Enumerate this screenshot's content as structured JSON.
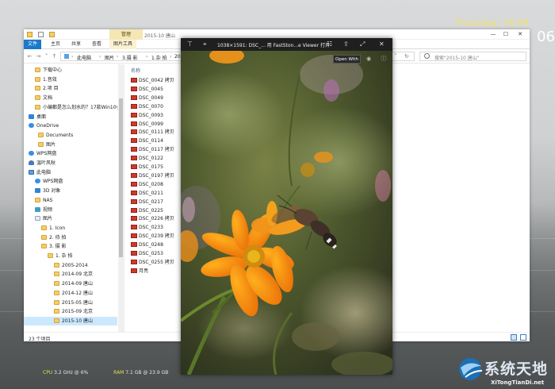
{
  "clock": {
    "day_time": "Thursday, 16:04",
    "big": "06"
  },
  "explorer": {
    "ribbon_context": "管理",
    "title": "2015-10 唐山",
    "tabs": [
      {
        "label": "文件"
      },
      {
        "label": "主页"
      },
      {
        "label": "共享"
      },
      {
        "label": "查看"
      },
      {
        "label": "图片工具"
      }
    ],
    "breadcrumbs": [
      "此电脑",
      "图片",
      "3.摄 影",
      "1.杂 拍",
      "20"
    ],
    "search_placeholder": "搜索\"2015-10 唐山\"",
    "nav": [
      {
        "label": "下载中心",
        "icon": "folder-icon"
      },
      {
        "label": "1.音效",
        "icon": "folder-icon"
      },
      {
        "label": "2.项 目",
        "icon": "folder-icon"
      },
      {
        "label": "文档",
        "icon": "folder-icon"
      },
      {
        "label": "小编都是怎么划水的？17款Win10小",
        "icon": "folder-icon"
      },
      {
        "label": "桌面",
        "icon": "desktop-icon"
      },
      {
        "label": "OneDrive",
        "icon": "cloud-icon"
      },
      {
        "label": "Documents",
        "icon": "folder-icon"
      },
      {
        "label": "图片",
        "icon": "folder-icon"
      },
      {
        "label": "WPS网盘",
        "icon": "cloud-icon"
      },
      {
        "label": "温叶风秋",
        "icon": "person-icon"
      },
      {
        "label": "此电脑",
        "icon": "computer-icon"
      },
      {
        "label": "WPS网盘",
        "icon": "cloud-icon"
      },
      {
        "label": "3D 对象",
        "icon": "cube-icon"
      },
      {
        "label": "NAS",
        "icon": "folder-icon"
      },
      {
        "label": "视频",
        "icon": "video-icon"
      },
      {
        "label": "图片",
        "icon": "pictures-icon"
      },
      {
        "label": "1. Icon",
        "icon": "folder-icon"
      },
      {
        "label": "2. 待 拍",
        "icon": "folder-icon"
      },
      {
        "label": "3. 摄 影",
        "icon": "folder-icon"
      },
      {
        "label": "1. 杂 拍",
        "icon": "folder-icon"
      },
      {
        "label": "2005-2014",
        "icon": "folder-icon"
      },
      {
        "label": "2014-09 北京",
        "icon": "folder-icon"
      },
      {
        "label": "2014-09 唐山",
        "icon": "folder-icon"
      },
      {
        "label": "2014-12 唐山",
        "icon": "folder-icon"
      },
      {
        "label": "2015-05 唐山",
        "icon": "folder-icon"
      },
      {
        "label": "2015-09 北京",
        "icon": "folder-icon"
      },
      {
        "label": "2015-10 唐山",
        "icon": "folder-icon",
        "selected": true
      }
    ],
    "column_name": "名称",
    "files": [
      "DSC_0042 拷贝",
      "DSC_0045",
      "DSC_0049",
      "DSC_0070",
      "DSC_0093",
      "DSC_0099",
      "DSC_0111 拷贝",
      "DSC_0114",
      "DSC_0117 拷贝",
      "DSC_0122",
      "DSC_0175",
      "DSC_0197 拷贝",
      "DSC_0208",
      "DSC_0211",
      "DSC_0217",
      "DSC_0225",
      "DSC_0226 拷贝",
      "DSC_0233",
      "DSC_0239 拷贝",
      "DSC_0248",
      "DSC_0253",
      "DSC_0255 拷贝",
      "月亮"
    ],
    "status_count": "23 个项目"
  },
  "viewer": {
    "title": "1038×1591: DSC_...  用 FastSton...e Viewer 打开",
    "tooltip": "Open With",
    "icons": [
      "pin-icon",
      "pin-outline-icon",
      "open-with-icon",
      "share-icon",
      "fullscreen-icon",
      "close-icon"
    ]
  },
  "meters": {
    "cpu_label": "CPU",
    "cpu_value": "3.2 GHz @ 6%",
    "ram_label": "RAM",
    "ram_value": "7.1 GB @ 23.9 GB"
  },
  "watermark": {
    "cn": "系统天地",
    "en": "XiTongTianDi.net"
  }
}
